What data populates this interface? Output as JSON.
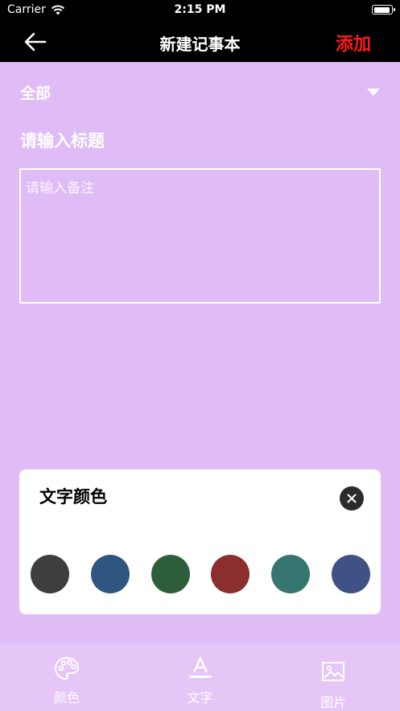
{
  "status_bar": {
    "carrier": "Carrier",
    "time": "2:15 PM"
  },
  "nav": {
    "title": "新建记事本",
    "add_label": "添加",
    "add_color": "#ff1a1a"
  },
  "category": {
    "selected": "全部"
  },
  "form": {
    "title_placeholder": "请输入标题",
    "note_placeholder": "请输入备注"
  },
  "text_color_panel": {
    "title": "文字颜色",
    "swatches": [
      "#3e3e3e",
      "#2f5680",
      "#2c5e3a",
      "#8a2e2e",
      "#377570",
      "#3f5185"
    ]
  },
  "tabs": [
    {
      "label": "颜色",
      "icon": "palette-icon"
    },
    {
      "label": "文字",
      "icon": "text-format-icon"
    },
    {
      "label": "图片",
      "icon": "image-icon"
    }
  ],
  "colors": {
    "background": "#e0bcf7",
    "tab_bar": "#e6c6f7",
    "header": "#000000"
  }
}
